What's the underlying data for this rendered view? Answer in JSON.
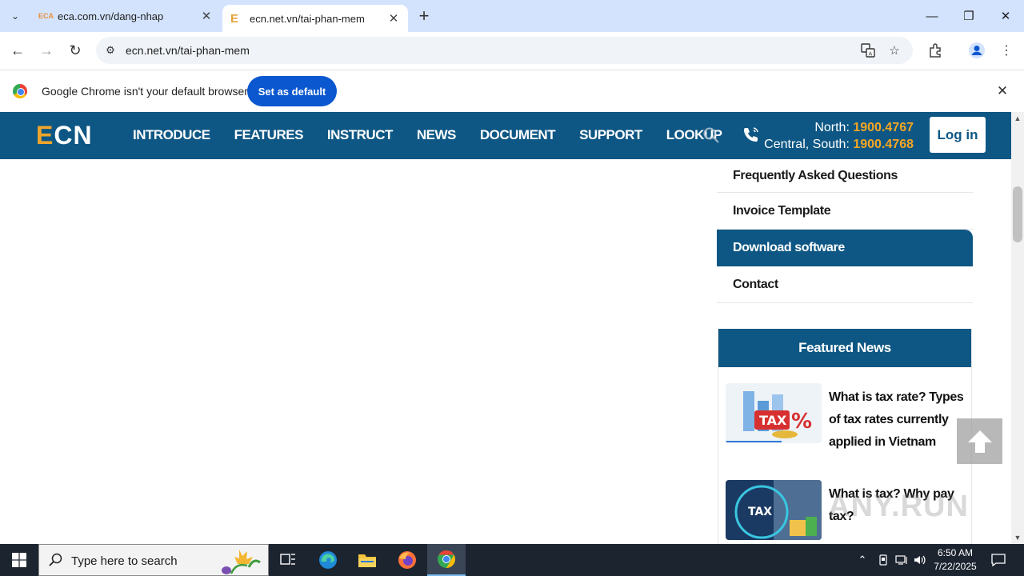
{
  "browser": {
    "tabs": [
      {
        "favicon": "ECA",
        "title": "eca.com.vn/dang-nhap"
      },
      {
        "favicon": "E",
        "title": "ecn.net.vn/tai-phan-mem"
      }
    ],
    "url": "ecn.net.vn/tai-phan-mem"
  },
  "infobar": {
    "message": "Google Chrome isn't your default browser",
    "button": "Set as default"
  },
  "site": {
    "logo_e": "E",
    "logo_rest": "CN",
    "nav": [
      "INTRODUCE",
      "FEATURES",
      "INSTRUCT",
      "NEWS",
      "DOCUMENT",
      "SUPPORT",
      "LOOKUP"
    ],
    "hotline": {
      "north_label": "North:",
      "north_number": "1900.4767",
      "south_label": "Central, South:",
      "south_number": "1900.4768"
    },
    "login": "Log in",
    "accent_color": "#0e5784",
    "highlight_color": "#f5a623"
  },
  "sidebar": {
    "items": [
      "Frequently Asked Questions",
      "Invoice Template",
      "Download software",
      "Contact"
    ],
    "active": "Download software"
  },
  "featured": {
    "heading": "Featured News",
    "news": [
      {
        "title": "What is tax rate? Types of tax rates currently applied in Vietnam"
      },
      {
        "title": "What is tax? Why pay tax?"
      }
    ]
  },
  "watermark": "ANY.RUN",
  "taskbar": {
    "search_placeholder": "Type here to search",
    "time": "6:50 AM",
    "date": "7/22/2025"
  }
}
